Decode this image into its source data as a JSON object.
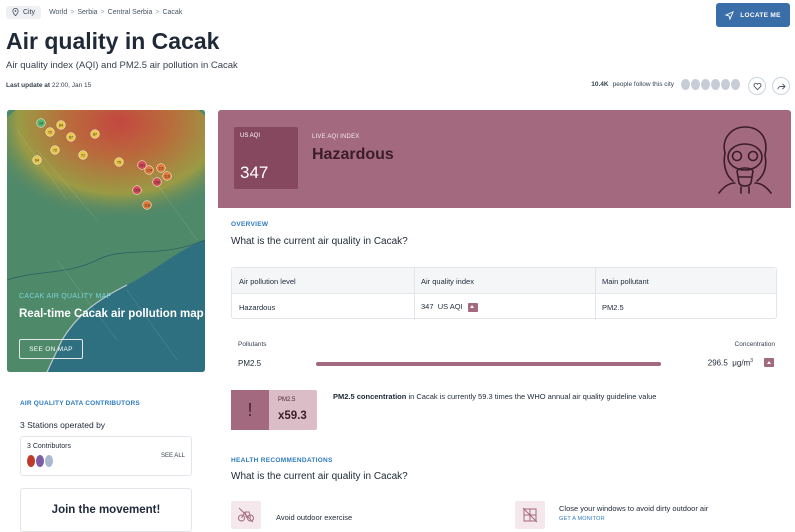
{
  "breadcrumb": {
    "pill": "City",
    "items": [
      "World",
      "Serbia",
      "Central Serbia",
      "Cacak"
    ],
    "sep": ">"
  },
  "header": {
    "locate_label": "LOCATE ME",
    "title": "Air quality in Cacak",
    "subtitle": "Air quality index (AQI) and PM2.5 air pollution in Cacak",
    "last_update_label": "Last update at",
    "last_update_value": "22:00, Jan 15",
    "followers_count": "10.4K",
    "followers_text": "people follow this city"
  },
  "map_card": {
    "kicker": "CACAK AIR QUALITY MAP",
    "title": "Real-time Cacak air pollution map",
    "button": "SEE ON MAP",
    "markers": [
      "14",
      "84",
      "72",
      "87",
      "87",
      "72",
      "64",
      "71",
      "75",
      "124",
      "161",
      "111",
      "116",
      "159",
      "159",
      "118"
    ]
  },
  "contributors": {
    "header": "AIR QUALITY DATA CONTRIBUTORS",
    "stations": "3 Stations operated by",
    "count": "3 Contributors",
    "see_all": "SEE ALL"
  },
  "join": "Join the movement!",
  "aqi": {
    "unit_label": "US AQI",
    "value": "347",
    "live_label": "LIVE AQI INDEX",
    "level": "Hazardous",
    "color": "#a3697e",
    "color_dark": "#86485e"
  },
  "overview": {
    "kicker": "OVERVIEW",
    "question": "What is the current air quality in Cacak?",
    "table": {
      "headers": [
        "Air pollution level",
        "Air quality index",
        "Main pollutant"
      ],
      "row": {
        "level": "Hazardous",
        "aqi": "347",
        "aqi_unit": "US AQI",
        "pollutant": "PM2.5"
      }
    },
    "pollutants_label": "Pollutants",
    "concentration_label": "Concentration",
    "pollutant": {
      "name": "PM2.5",
      "value": "296.5",
      "unit": "μg/m",
      "unit_sup": "3"
    },
    "who": {
      "mark": "!",
      "pollutant": "PM2.5",
      "factor": "x59.3",
      "text_bold": "PM2.5 concentration",
      "text_rest": " in Cacak is currently 59.3 times the WHO annual air quality guideline value"
    }
  },
  "health": {
    "kicker": "HEALTH RECOMMENDATIONS",
    "question": "What is the current air quality in Cacak?",
    "items": [
      {
        "text": "Avoid outdoor exercise",
        "sub": ""
      },
      {
        "text": "Close your windows to avoid dirty outdoor air",
        "sub": "GET A MONITOR"
      }
    ]
  }
}
